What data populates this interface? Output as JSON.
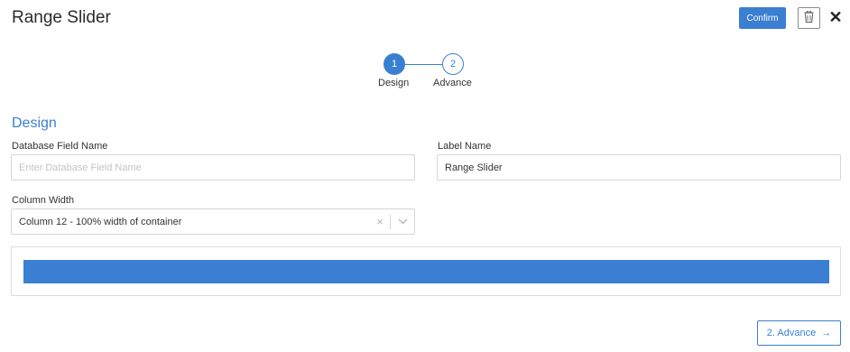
{
  "header": {
    "title": "Range Slider",
    "confirm_label": "Confirm",
    "delete_icon": "trash-icon",
    "close_icon": "close-icon",
    "close_glyph": "✕"
  },
  "stepper": {
    "steps": [
      {
        "number": "1",
        "label": "Design",
        "active": true
      },
      {
        "number": "2",
        "label": "Advance",
        "active": false
      }
    ]
  },
  "section": {
    "title": "Design"
  },
  "fields": {
    "database_field": {
      "label": "Database Field Name",
      "value": "",
      "placeholder": "Enter Database Field Name"
    },
    "label_name": {
      "label": "Label Name",
      "value": "Range Slider",
      "placeholder": ""
    },
    "column_width": {
      "label": "Column Width",
      "value": "Column 12 - 100% width of container",
      "clear_glyph": "×"
    }
  },
  "footer": {
    "advance_label": "2. Advance",
    "advance_arrow": "→"
  },
  "colors": {
    "accent": "#3a7fd1",
    "border": "#d6d6d6",
    "text": "#333333"
  }
}
